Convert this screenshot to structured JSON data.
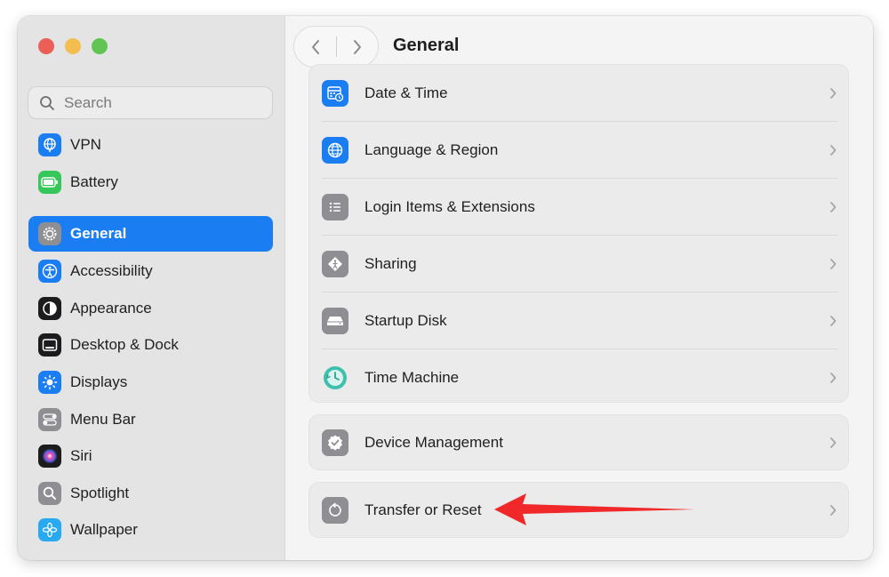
{
  "window": {
    "title": "General"
  },
  "sidebar": {
    "search_placeholder": "Search",
    "items": [
      {
        "label": "VPN",
        "icon": "vpn-globe-icon",
        "color": "#1a7ef2"
      },
      {
        "label": "Battery",
        "icon": "battery-icon",
        "color": "#35c759"
      },
      {
        "label": "General",
        "icon": "gear-icon",
        "color": "#8e8e93",
        "selected": true
      },
      {
        "label": "Accessibility",
        "icon": "accessibility-icon",
        "color": "#1a7ef2"
      },
      {
        "label": "Appearance",
        "icon": "appearance-icon",
        "color": "#1c1c1e"
      },
      {
        "label": "Desktop & Dock",
        "icon": "dock-icon",
        "color": "#1c1c1e"
      },
      {
        "label": "Displays",
        "icon": "sun-icon",
        "color": "#1a7ef2"
      },
      {
        "label": "Menu Bar",
        "icon": "toggles-icon",
        "color": "#8e8e93"
      },
      {
        "label": "Siri",
        "icon": "siri-icon",
        "color": "#5e3ea8"
      },
      {
        "label": "Spotlight",
        "icon": "magnifier-icon",
        "color": "#8e8e93"
      },
      {
        "label": "Wallpaper",
        "icon": "flower-icon",
        "color": "#29a9f0"
      }
    ]
  },
  "main": {
    "groups": [
      {
        "rows": [
          {
            "label": "Date & Time",
            "icon": "calendar-clock-icon",
            "color": "#1a7ef2"
          },
          {
            "label": "Language & Region",
            "icon": "globe-icon",
            "color": "#1a7ef2"
          },
          {
            "label": "Login Items & Extensions",
            "icon": "list-icon",
            "color": "#8e8e93"
          },
          {
            "label": "Sharing",
            "icon": "sharing-icon",
            "color": "#8e8e93"
          },
          {
            "label": "Startup Disk",
            "icon": "disk-icon",
            "color": "#8e8e93"
          },
          {
            "label": "Time Machine",
            "icon": "time-machine-icon",
            "color": "#3fbfad"
          }
        ]
      },
      {
        "rows": [
          {
            "label": "Device Management",
            "icon": "checkmark-seal-icon",
            "color": "#8e8e93"
          }
        ]
      },
      {
        "rows": [
          {
            "label": "Transfer or Reset",
            "icon": "reset-icon",
            "color": "#8e8e93"
          }
        ]
      }
    ]
  },
  "annotation": {
    "arrow_color": "#f0282a",
    "target": "Transfer or Reset"
  }
}
